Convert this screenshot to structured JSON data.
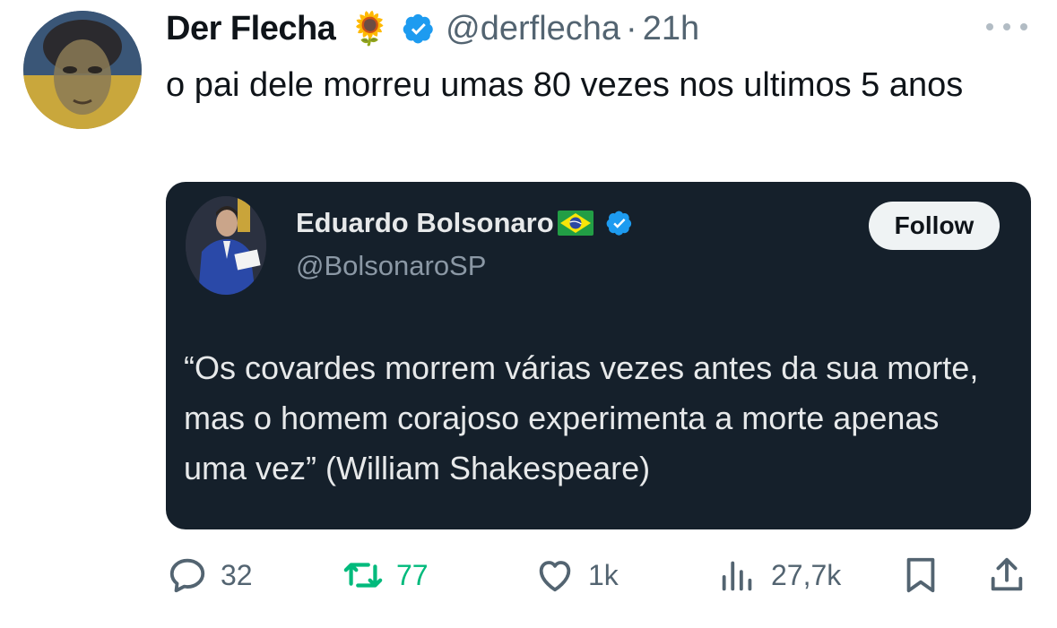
{
  "author": {
    "name": "Der Flecha",
    "emoji": "🌻",
    "handle": "@derflecha",
    "separator": "·",
    "time": "21h",
    "verified_icon": "verified-badge-icon"
  },
  "tweet_text": "o pai dele morreu umas 80 vezes nos ultimos 5 anos",
  "quoted": {
    "name": "Eduardo Bolsonaro",
    "flag_icon": "brazil-flag-icon",
    "handle": "@BolsonaroSP",
    "follow_label": "Follow",
    "text": "“Os covardes morrem várias vezes antes da sua morte, mas o homem corajoso experimenta a morte apenas uma vez” (William Shakespeare)"
  },
  "actions": {
    "replies": "32",
    "retweets": "77",
    "likes": "1k",
    "views": "27,7k"
  },
  "colors": {
    "text": "#0f1419",
    "secondary": "#536471",
    "verified": "#1d9bf0",
    "retweet_green": "#00ba7c",
    "card_bg": "#15202b"
  }
}
